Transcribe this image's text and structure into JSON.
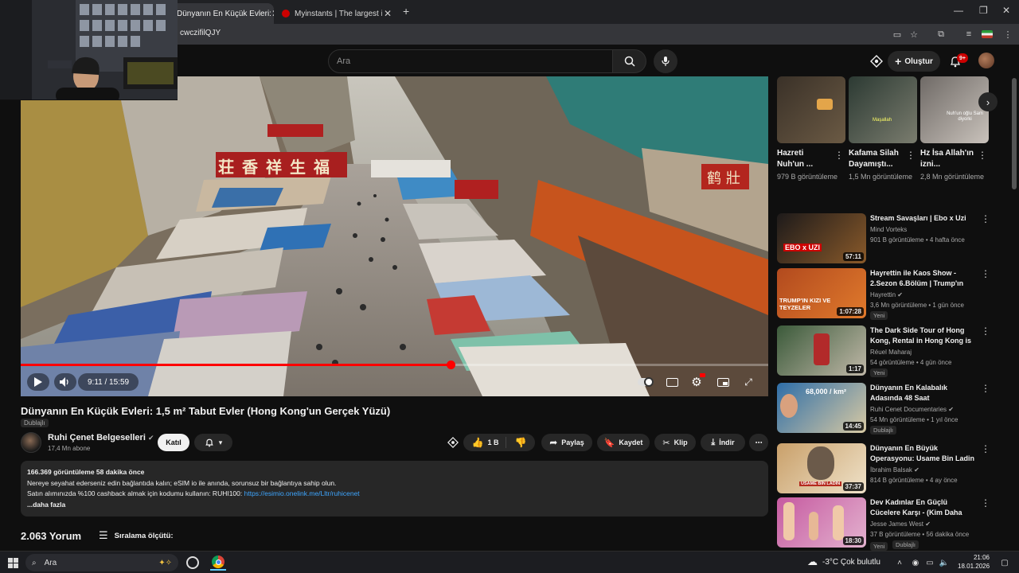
{
  "browser": {
    "tabs": [
      {
        "title": "Dünyanın En Küçük Evleri:",
        "active": true
      },
      {
        "title": "Myinstants | The largest instan",
        "active": false
      }
    ],
    "url": "cwczifilQJY",
    "new_tab": "+",
    "close_glyph": "✕"
  },
  "header": {
    "search_placeholder": "Ara",
    "create_label": "Oluştur",
    "notification_count": "9+"
  },
  "video": {
    "time": "9:11 / 15:59",
    "progress": 0.575,
    "title": "Dünyanın En Küçük Evleri: 1,5 m² Tabut Evler (Hong Kong'un Gerçek Yüzü)",
    "dub_tag": "Dublajlı",
    "channel_name": "Ruhi Çenet Belgeselleri",
    "channel_subs": "17,4 Mn abone",
    "join_label": "Katıl",
    "like_count": "1 B",
    "share_label": "Paylaş",
    "save_label": "Kaydet",
    "clip_label": "Klip",
    "download_label": "İndir",
    "shop_signs": [
      "荘",
      "香",
      "祥",
      "生",
      "福",
      "鹤",
      "壯"
    ]
  },
  "description": {
    "meta": "166.369 görüntüleme  58 dakika önce",
    "line1": "Nereye seyahat ederseniz edin bağlantıda kalın; eSIM io ile anında, sorunsuz bir bağlantıya sahip olun.",
    "line2_prefix": "Satın alımınızda %100 cashback almak için kodumu kullanın: RUHI100: ",
    "line2_link": "https://esimio.onelink.me/Lltr/ruhicenet",
    "more": "...daha fazla"
  },
  "comments": {
    "count": "2.063 Yorum",
    "sort_label": "Sıralama ölçütü:"
  },
  "shorts": [
    {
      "title": "Hazreti Nuh'un ...",
      "views": "979 B görüntüleme",
      "colors": [
        "#3a3128",
        "#6b5a44"
      ]
    },
    {
      "title": "Kafama Silah Dayamıştı...",
      "views": "1,5 Mn görüntüleme",
      "colors": [
        "#2c3a33",
        "#7a7c6e"
      ],
      "caption": "Maşallah"
    },
    {
      "title": "Hz İsa Allah'ın izni...",
      "views": "2,8 Mn görüntüleme",
      "colors": [
        "#6f6a66",
        "#c9c2bb"
      ],
      "caption": "Nuh'un oğlu Sam diyorki"
    }
  ],
  "recommended": [
    {
      "title": "Stream Savaşları | Ebo x Uzi",
      "channel": "Mind Vorteks",
      "meta": "901 B görüntüleme • 4 hafta önce",
      "duration": "57:11",
      "verified": false,
      "badge": "",
      "colors": [
        "#1d1a1a",
        "#8a5a2a"
      ],
      "thumb_text": "EBO x UZI"
    },
    {
      "title": "Hayrettin ile Kaos Show - 2.Sezon 6.Bölüm | Trump'ın Kı...",
      "channel": "Hayrettin",
      "meta": "3,6 Mn görüntüleme • 1 gün önce",
      "duration": "1:07:28",
      "verified": true,
      "badge": "Yeni",
      "colors": [
        "#b24a1e",
        "#e07a2c"
      ],
      "thumb_text": "TRUMP'IN KIZI VE TEYZELER"
    },
    {
      "title": "The Dark Side Tour of Hong Kong, Rental in Hong Kong is ...",
      "channel": "Réuel Maharaj",
      "meta": "54 görüntüleme • 4 gün önce",
      "duration": "1:17",
      "verified": false,
      "badge": "Yeni",
      "colors": [
        "#3b5a3a",
        "#c0b8a8"
      ],
      "thumb_text": ""
    },
    {
      "title": "Dünyanın En Kalabalık Adasında 48 Saat (Gördüklerimi ...",
      "channel": "Ruhi Cenet Documentaries",
      "meta": "54 Mn görüntüleme • 1 yıl önce",
      "duration": "14:45",
      "verified": true,
      "badge": "Dublajlı",
      "colors": [
        "#2e6ea8",
        "#d8c9a3"
      ],
      "thumb_text": "68,000 / km²"
    },
    {
      "title": "Dünyanın En Büyük Operasyonu: Usame Bin Ladin Gerçekten ...",
      "channel": "İbrahim Balsak",
      "meta": "814 B görüntüleme • 4 ay önce",
      "duration": "37:37",
      "verified": true,
      "badge": "",
      "colors": [
        "#c9a06a",
        "#efe2c9"
      ],
      "thumb_text": "USAME BİN LADİN"
    },
    {
      "title": "Dev Kadınlar En Güçlü Cücelere Karşı - (Kim Daha Güçlü?)",
      "channel": "Jesse James West",
      "meta": "37 B görüntüleme • 56 dakika önce",
      "duration": "18:30",
      "verified": true,
      "badge": "Yeni",
      "badge2": "Dublajlı",
      "colors": [
        "#c65aa0",
        "#e3b2cf"
      ],
      "thumb_text": ""
    }
  ],
  "taskbar": {
    "search": "Ara",
    "weather": "-3°C  Çok bulutlu",
    "time": "21:06",
    "date": "18.01.2026"
  },
  "colors": {
    "accent": "#ff0000",
    "link": "#3ea6ff",
    "bg": "#0f0f0f",
    "surface": "#272727"
  }
}
